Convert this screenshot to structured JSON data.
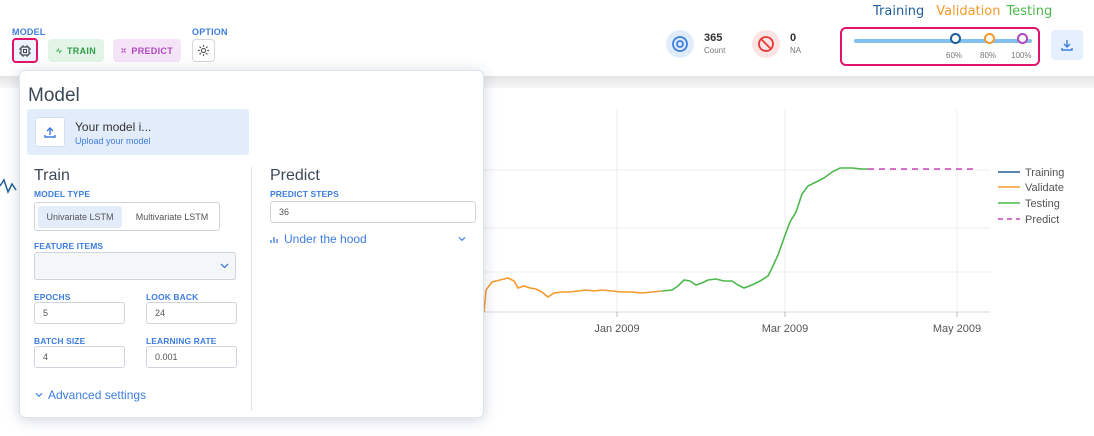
{
  "toolbar": {
    "model_label": "MODEL",
    "option_label": "OPTION",
    "train_label": "TRAIN",
    "predict_label": "PREDICT"
  },
  "stats": {
    "count_value": "365",
    "count_label": "Count",
    "na_value": "0",
    "na_label": "NA"
  },
  "split_legend": {
    "training": "Training",
    "validation": "Validation",
    "testing": "Testing"
  },
  "split": {
    "pct_60": "60%",
    "pct_80": "80%",
    "pct_100": "100%"
  },
  "colors": {
    "training": "#1f5f99",
    "validation": "#f39a2b",
    "testing": "#4cb84c",
    "predict": "#cc44b8",
    "accent": "#3d7de0",
    "highlight": "#e0136b"
  },
  "panel": {
    "title": "Model",
    "upload_title": "Your model i...",
    "upload_sub": "Upload your model",
    "train_title": "Train",
    "model_type_label": "MODEL TYPE",
    "univariate": "Univariate LSTM",
    "multivariate": "Multivariate LSTM",
    "feature_items_label": "FEATURE ITEMS",
    "epochs_label": "EPOCHS",
    "epochs_value": "5",
    "look_back_label": "LOOK BACK",
    "look_back_value": "24",
    "batch_size_label": "BATCH SIZE",
    "batch_size_value": "4",
    "learning_rate_label": "LEARNING RATE",
    "learning_rate_value": "0.001",
    "advanced_label": "Advanced settings",
    "predict_title": "Predict",
    "predict_steps_label": "PREDICT STEPS",
    "predict_steps_value": "36",
    "under_hood_label": "Under the hood"
  },
  "chart_legend": {
    "training": "Training",
    "validate": "Validate",
    "testing": "Testing",
    "predict": "Predict"
  },
  "chart_data": {
    "type": "line",
    "x_ticks": [
      "Jan 2009",
      "Mar 2009",
      "May 2009"
    ],
    "series": [
      {
        "name": "Training"
      },
      {
        "name": "Validate"
      },
      {
        "name": "Testing"
      },
      {
        "name": "Predict"
      }
    ],
    "legend_position": "right"
  }
}
